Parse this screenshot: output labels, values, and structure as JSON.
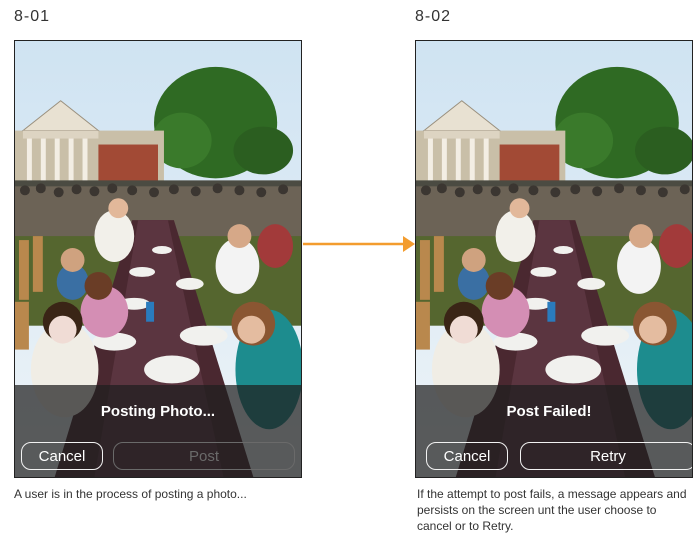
{
  "screens": [
    {
      "label": "8-01",
      "status": "Posting Photo...",
      "cancel_label": "Cancel",
      "primary_label": "Post",
      "caption": "A user is in the process of posting a photo..."
    },
    {
      "label": "8-02",
      "status": "Post Failed!",
      "cancel_label": "Cancel",
      "primary_label": "Retry",
      "caption": "If the attempt to post fails, a message appears and persists on the screen unt the user choose to cancel or to Retry."
    }
  ],
  "colors": {
    "arrow": "#f39c2e",
    "overlay": "#1e1e1e"
  },
  "icons": {
    "transition": "arrow-right-icon"
  }
}
